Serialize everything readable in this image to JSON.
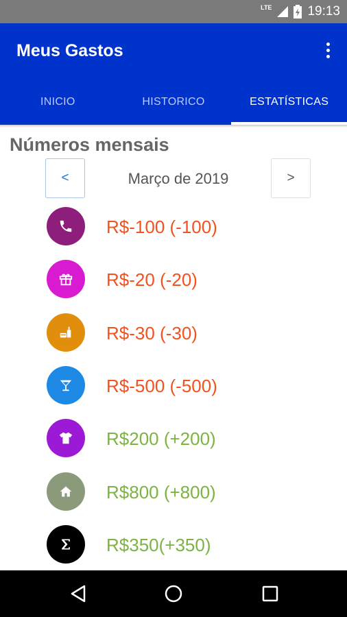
{
  "status_bar": {
    "network": "LTE",
    "time": "19:13"
  },
  "app_bar": {
    "title": "Meus Gastos",
    "menu_icon": "more-vert-icon"
  },
  "tabs": [
    {
      "label": "INICIO",
      "active": false
    },
    {
      "label": "HISTORICO",
      "active": false
    },
    {
      "label": "ESTATÍSTICAS",
      "active": true
    }
  ],
  "stats": {
    "title": "Números mensais",
    "prev_label": "<",
    "next_label": ">",
    "month": "Março de 2019",
    "items": [
      {
        "icon": "phone-icon",
        "color": "#8e1e7c",
        "text": "R$-100 (-100)",
        "sign": "negative"
      },
      {
        "icon": "gift-icon",
        "color": "#d81bd1",
        "text": "R$-20 (-20)",
        "sign": "negative"
      },
      {
        "icon": "food-icon",
        "color": "#e08e0b",
        "text": "R$-30 (-30)",
        "sign": "negative"
      },
      {
        "icon": "cocktail-icon",
        "color": "#1e88e5",
        "text": "R$-500 (-500)",
        "sign": "negative"
      },
      {
        "icon": "shirt-icon",
        "color": "#9c1ad6",
        "text": "R$200 (+200)",
        "sign": "positive"
      },
      {
        "icon": "home-icon",
        "color": "#8a9a7b",
        "text": "R$800 (+800)",
        "sign": "positive"
      },
      {
        "icon": "sigma-icon",
        "color": "#000000",
        "text": "R$350(+350)",
        "sign": "positive"
      }
    ]
  },
  "colors": {
    "primary": "#0033cc",
    "negative": "#f4511e",
    "positive": "#7cb342"
  }
}
